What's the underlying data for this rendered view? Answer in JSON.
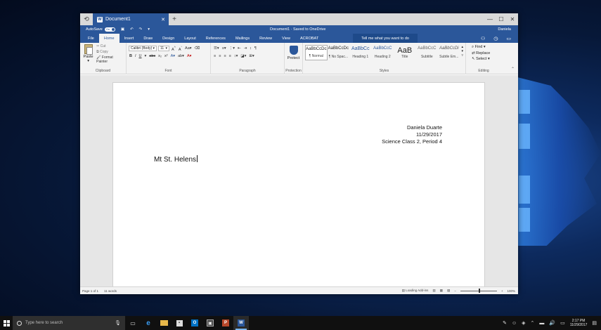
{
  "window": {
    "tab_title": "Document1",
    "title": "Document1  ·  Saved to OneDrive",
    "user": "Daniela",
    "autosave_label": "AutoSave",
    "autosave_state": "On"
  },
  "ribbon_tabs": [
    "File",
    "Home",
    "Insert",
    "Draw",
    "Design",
    "Layout",
    "References",
    "Mailings",
    "Review",
    "View",
    "ACROBAT"
  ],
  "active_tab": "Home",
  "tell_me": "Tell me what you want to do",
  "clipboard": {
    "paste": "Paste",
    "cut": "Cut",
    "copy": "Copy",
    "format_painter": "Format Painter",
    "label": "Clipboard"
  },
  "font": {
    "name": "Calibri (Body)",
    "size": "11",
    "label": "Font"
  },
  "paragraph": {
    "label": "Paragraph"
  },
  "protection": {
    "button": "Protect",
    "label": "Protection"
  },
  "styles": {
    "items": [
      {
        "preview": "AaBbCcDc",
        "name": "¶ Normal"
      },
      {
        "preview": "AaBbCcDc",
        "name": "¶ No Spac..."
      },
      {
        "preview": "AaBbCc",
        "name": "Heading 1"
      },
      {
        "preview": "AaBbCcC",
        "name": "Heading 2"
      },
      {
        "preview": "AaB",
        "name": "Title"
      },
      {
        "preview": "AaBbCcC",
        "name": "Subtitle"
      },
      {
        "preview": "AaBbCcDi",
        "name": "Subtle Em..."
      }
    ],
    "label": "Styles"
  },
  "editing": {
    "find": "Find",
    "replace": "Replace",
    "select": "Select",
    "label": "Editing"
  },
  "document": {
    "author": "Daniela Duarte",
    "date": "11/29/2017",
    "class": "Science Class 2, Period 4",
    "title": "Mt St. Helens"
  },
  "status": {
    "page": "Page 1 of 1",
    "words": "11 words",
    "addins": "Loading Add-ins",
    "zoom": "100%"
  },
  "taskbar": {
    "search_placeholder": "Type here to search",
    "time": "2:17 PM",
    "date": "11/29/2017"
  }
}
